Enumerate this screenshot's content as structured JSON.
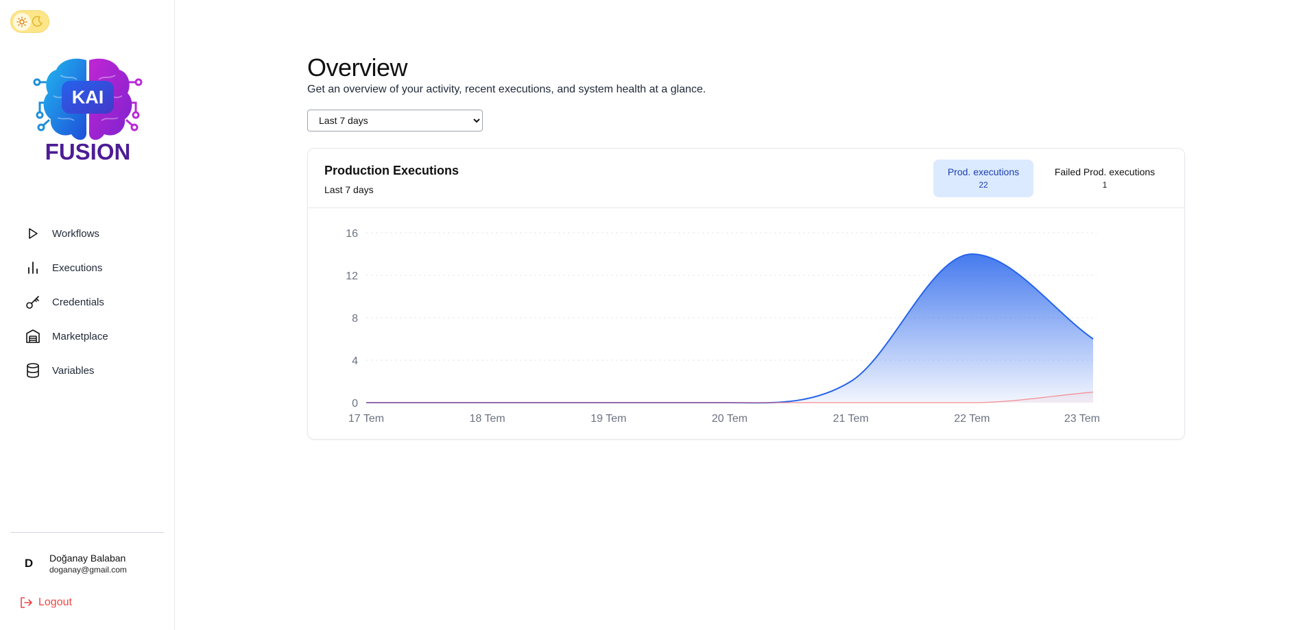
{
  "sidebar": {
    "logo": {
      "text_top": "KAI",
      "text_bottom": "FUSION"
    },
    "items": [
      {
        "label": "Workflows",
        "icon": "play-icon"
      },
      {
        "label": "Executions",
        "icon": "bar-chart-icon"
      },
      {
        "label": "Credentials",
        "icon": "key-icon"
      },
      {
        "label": "Marketplace",
        "icon": "store-icon"
      },
      {
        "label": "Variables",
        "icon": "database-icon"
      }
    ],
    "user": {
      "initial": "D",
      "name": "Doğanay Balaban",
      "email": "doganay@gmail.com"
    },
    "logout_label": "Logout"
  },
  "main": {
    "title": "Overview",
    "subtitle": "Get an overview of your activity, recent executions, and system health at a glance.",
    "range": {
      "selected": "Last 7 days",
      "options": [
        "Last 7 days"
      ]
    },
    "card": {
      "title": "Production Executions",
      "subtitle": "Last 7 days",
      "tabs": [
        {
          "label": "Prod. executions",
          "value": "22",
          "active": true
        },
        {
          "label": "Failed Prod. executions",
          "value": "1",
          "active": false
        }
      ]
    }
  },
  "colors": {
    "accent": "#2563eb",
    "failed": "#f87171",
    "logout": "#ef4444"
  },
  "chart_data": {
    "type": "area",
    "x": [
      "17 Tem",
      "18 Tem",
      "19 Tem",
      "20 Tem",
      "21 Tem",
      "22 Tem",
      "23 Tem"
    ],
    "series": [
      {
        "name": "Prod. executions",
        "values": [
          0,
          0,
          0,
          0,
          2,
          14,
          6
        ]
      },
      {
        "name": "Failed Prod. executions",
        "values": [
          0,
          0,
          0,
          0,
          0,
          0,
          1
        ]
      }
    ],
    "yticks": [
      0,
      4,
      8,
      12,
      16
    ],
    "ylim": [
      0,
      16
    ],
    "grid": true
  }
}
